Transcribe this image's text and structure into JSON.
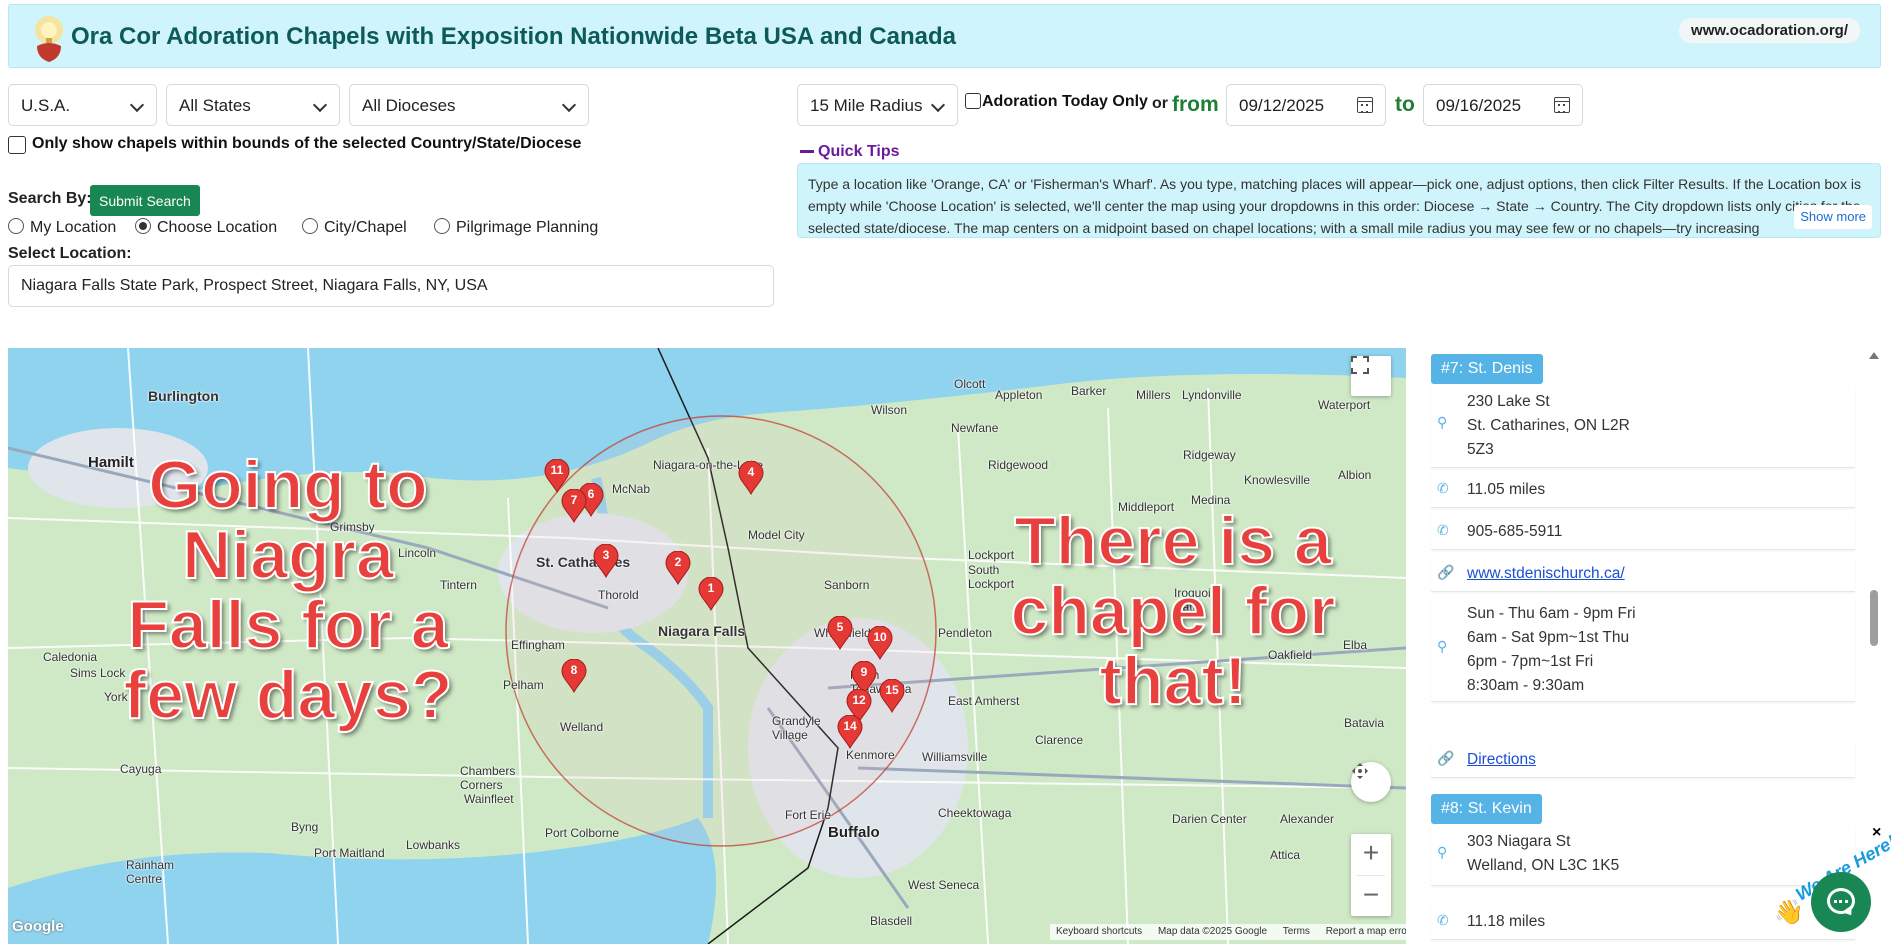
{
  "header": {
    "title": "Ora Cor Adoration Chapels with Exposition Nationwide Beta USA and Canada",
    "url": "www.ocadoration.org/"
  },
  "filters": {
    "country": "U.S.A.",
    "state": "All States",
    "diocese": "All Dioceses",
    "radius": "15 Mile Radius",
    "adoration_today_label": "Adoration Today Only",
    "or_label": "or",
    "from_label": "from",
    "to_label": "to",
    "from_date": "09/12/2025",
    "to_date": "09/16/2025",
    "bounds_label": "Only show chapels within bounds of the selected Country/State/Diocese"
  },
  "quick_tips": {
    "title": "Quick Tips",
    "text": "Type a location like 'Orange, CA' or 'Fisherman's Wharf'. As you type, matching places will appear—pick one, adjust options, then click Filter Results. If the Location box is empty while 'Choose Location' is selected, we'll center the map using your dropdowns in this order: Diocese → State → Country. The City dropdown lists only cities for the selected state/diocese. The map centers on a midpoint based on chapel locations; with a small mile radius you may see few or no chapels—try increasing",
    "show_more": "Show more"
  },
  "search": {
    "search_by_label": "Search By:",
    "submit_label": "Submit Search",
    "options": [
      "My Location",
      "Choose Location",
      "City/Chapel",
      "Pilgrimage Planning"
    ],
    "selected": "Choose Location",
    "select_location_label": "Select Location:",
    "location_value": "Niagara Falls State Park, Prospect Street, Niagara Falls, NY, USA"
  },
  "map": {
    "overlay_left": "Going to Niagra Falls for a few days?",
    "overlay_right": "There is a chapel for that!",
    "places": {
      "burlington": "Burlington",
      "hamilton": "Hamilt",
      "grimsby": "Grimsby",
      "lincoln": "Lincoln",
      "st_catharines": "St. Catharines",
      "thorold": "Thorold",
      "niagara_falls": "Niagara Falls",
      "niagara_on_the_lake": "Niagara-on-the-Lake",
      "mcnab": "McNab",
      "model_city": "Model City",
      "wilson": "Wilson",
      "olcott": "Olcott",
      "appleton": "Appleton",
      "barker": "Barker",
      "millers": "Millers",
      "lyndonville": "Lyndonville",
      "waterport": "Waterport",
      "newfane": "Newfane",
      "ridgewood": "Ridgewood",
      "ridgeway": "Ridgeway",
      "knowlesville": "Knowlesville",
      "albion": "Albion",
      "middleport": "Middleport",
      "medina": "Medina",
      "lockport": "Lockport",
      "south_lockport": "South\nLockport",
      "sanborn": "Sanborn",
      "wheatfield": "Wheatfield",
      "pendleton": "Pendleton",
      "north_tonawanda": "North\nTonawanda",
      "east_amherst": "East Amherst",
      "grand_island": "Grandyle\nVillage",
      "williamsville": "Williamsville",
      "clarence": "Clarence",
      "kenmore": "Kenmore",
      "buffalo": "Buffalo",
      "cheektowaga": "Cheektowaga",
      "fort_erie": "Fort Erie",
      "west_seneca": "West Seneca",
      "blasdell": "Blasdell",
      "darien_center": "Darien Center",
      "alexander": "Alexander",
      "attica": "Attica",
      "batavia": "Batavia",
      "elba": "Elba",
      "oakfield": "Oakfield",
      "welland": "Welland",
      "pelham": "Pelham",
      "effingham": "Effingham",
      "tintern": "Tintern",
      "caledonia": "Caledonia",
      "sims_lock": "Sims Lock",
      "york": "York",
      "cayuga": "Cayuga",
      "chambers_corners": "Chambers\nCorners",
      "wainfleet": "Wainfleet",
      "byng": "Byng",
      "port_colborne": "Port Colborne",
      "port_maitland": "Port Maitland",
      "lowbanks": "Lowbanks",
      "rainham_centre": "Rainham\nCentre",
      "iroquois": "Iroquois\nNatio"
    },
    "pins": [
      "1",
      "2",
      "3",
      "4",
      "5",
      "6",
      "7",
      "8",
      "9",
      "10",
      "11",
      "12",
      "14",
      "15"
    ],
    "controls": {
      "keyboard": "Keyboard shortcuts",
      "map_data": "Map data ©2025 Google",
      "terms": "Terms",
      "report": "Report a map error",
      "logo": "Google"
    }
  },
  "results": [
    {
      "badge": "#7: St. Denis",
      "address": "230 Lake St\nSt. Catharines, ON L2R\n5Z3",
      "distance": "11.05 miles",
      "phone": "905-685-5911",
      "website": "www.stdenischurch.ca/",
      "hours": "Sun - Thu 6am - 9pm Fri\n6am - Sat 9pm~1st Thu\n6pm - 7pm~1st Fri\n8:30am - 9:30am",
      "directions": "Directions"
    },
    {
      "badge": "#8: St. Kevin",
      "address": "303 Niagara St\nWelland, ON L3C 1K5",
      "distance": "11.18 miles"
    }
  ],
  "chat": {
    "tagline": "We Are Here!",
    "close": "×"
  },
  "colors": {
    "accent_green": "#198754",
    "header_bg": "#cff4fb",
    "badge_blue": "#55b3e6",
    "pin_red": "#e53935",
    "overlay_red": "#e8403d"
  }
}
